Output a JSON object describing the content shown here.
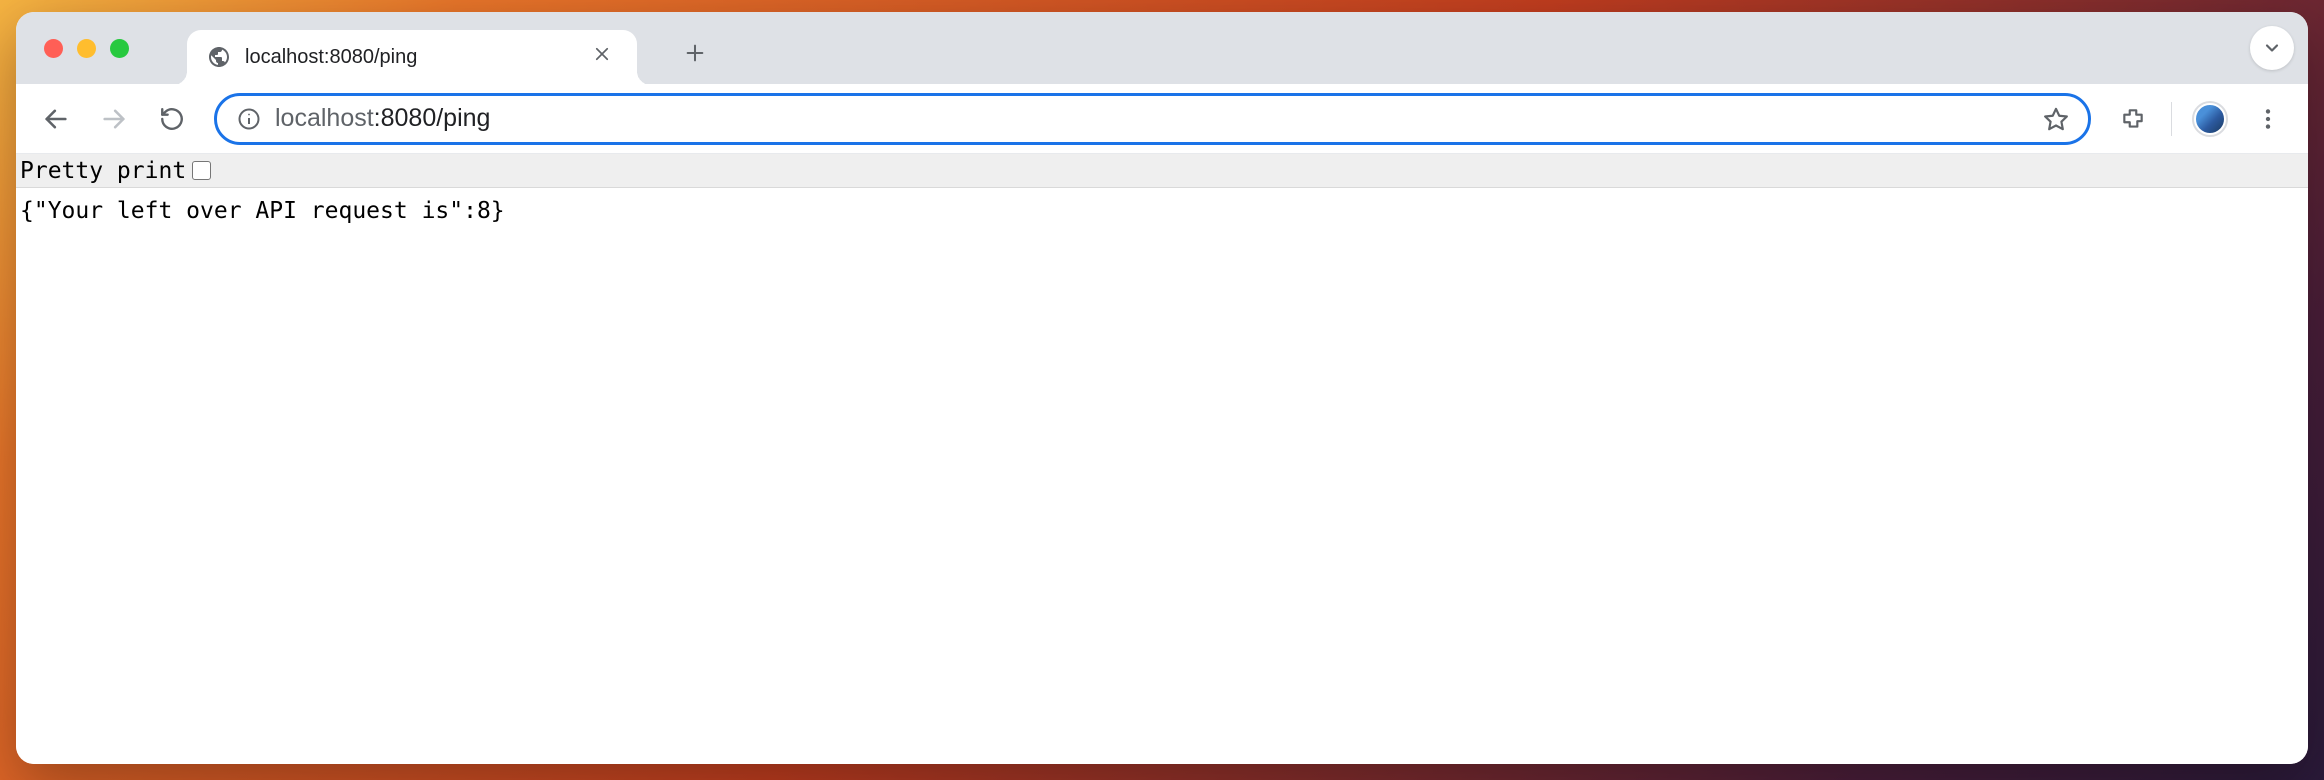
{
  "tab": {
    "title": "localhost:8080/ping"
  },
  "address": {
    "host_prefix": "localhost",
    "port_path": ":8080/ping"
  },
  "page": {
    "pretty_print_label": "Pretty print",
    "body_text": "{\"Your left over API request is\":8}"
  }
}
